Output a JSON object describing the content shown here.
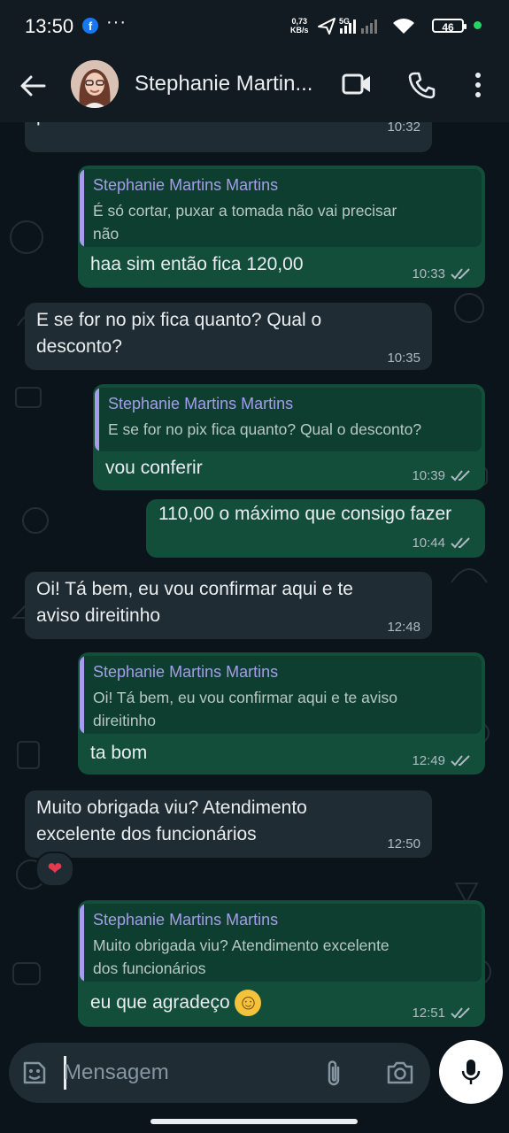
{
  "status_bar": {
    "time": "13:50",
    "facebook_glyph": "f",
    "more_glyph": "···",
    "speed_value": "0,73",
    "speed_unit": "KB/s",
    "network": "5G",
    "battery": "46"
  },
  "header": {
    "contact_name": "Stephanie Martin...",
    "icons": [
      "back-arrow-icon",
      "video-call-icon",
      "voice-call-icon",
      "more-vertical-icon"
    ]
  },
  "messages": [
    {
      "direction": "in",
      "text": "precisar não",
      "time": "10:32"
    },
    {
      "direction": "out",
      "quote": {
        "author": "Stephanie Martins Martins",
        "lines": [
          "É só cortar, puxar a tomada não vai precisar",
          "não"
        ]
      },
      "text": "haa sim então fica 120,00",
      "time": "10:33"
    },
    {
      "direction": "in",
      "lines": [
        "E se for no pix fica quanto? Qual o",
        "desconto?"
      ],
      "time": "10:35"
    },
    {
      "direction": "out",
      "quote": {
        "author": "Stephanie Martins Martins",
        "lines": [
          "E se for no pix fica quanto? Qual o desconto?"
        ]
      },
      "text": "vou conferir",
      "time": "10:39"
    },
    {
      "direction": "out",
      "text": "110,00 o máximo que consigo fazer",
      "time": "10:44"
    },
    {
      "direction": "in",
      "lines": [
        "Oi! Tá bem, eu vou confirmar aqui e te",
        "aviso direitinho"
      ],
      "time": "12:48"
    },
    {
      "direction": "out",
      "quote": {
        "author": "Stephanie Martins Martins",
        "lines": [
          "Oi! Tá bem, eu vou confirmar aqui e te aviso",
          "direitinho"
        ]
      },
      "text": "ta bom",
      "time": "12:49"
    },
    {
      "direction": "in",
      "lines": [
        "Muito obrigada viu? Atendimento",
        "excelente dos funcionários"
      ],
      "time": "12:50",
      "reaction": "❤"
    },
    {
      "direction": "out",
      "quote": {
        "author": "Stephanie Martins Martins",
        "lines": [
          "Muito obrigada viu? Atendimento excelente",
          "dos funcionários"
        ]
      },
      "text": "eu que agradeço",
      "emoji": "☺",
      "time": "12:51"
    }
  ],
  "composer": {
    "placeholder": "Mensagem",
    "icons": [
      "sticker-icon",
      "attach-icon",
      "camera-icon",
      "mic-icon"
    ]
  },
  "colors": {
    "background": "#0b141a",
    "incoming_bubble": "#202c33",
    "outgoing_bubble": "#134e3a",
    "quote_accent": "#a59dea",
    "online": "#25d366"
  }
}
